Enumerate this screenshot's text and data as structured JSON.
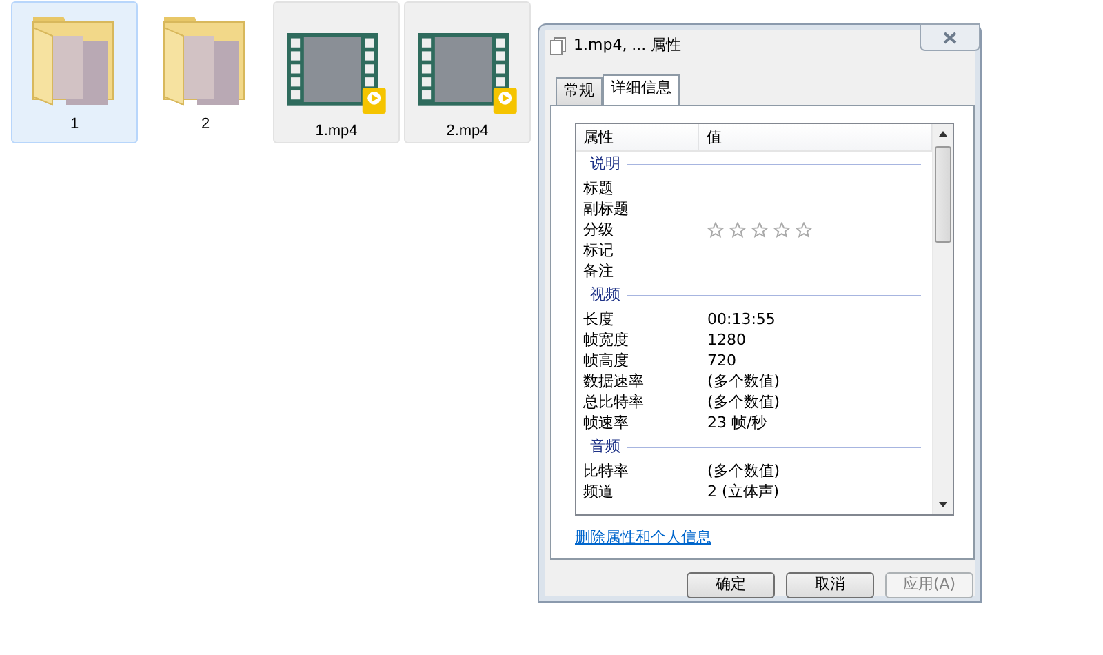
{
  "files": [
    {
      "name": "1",
      "kind": "folder",
      "selected": true
    },
    {
      "name": "2",
      "kind": "folder",
      "selected": false
    },
    {
      "name": "1.mp4",
      "kind": "video",
      "selected": false
    },
    {
      "name": "2.mp4",
      "kind": "video",
      "selected": false
    }
  ],
  "dialog": {
    "title": "1.mp4, ... 属性",
    "tabs": [
      {
        "label": "常规",
        "selected": false
      },
      {
        "label": "详细信息",
        "selected": true
      }
    ],
    "columns": [
      "属性",
      "值"
    ],
    "groups": [
      {
        "title": "说明",
        "rows": [
          {
            "name": "标题"
          },
          {
            "name": "副标题"
          },
          {
            "name": "分级",
            "kind": "stars",
            "stars": 0
          },
          {
            "name": "标记"
          },
          {
            "name": "备注"
          }
        ]
      },
      {
        "title": "视频",
        "rows": [
          {
            "name": "长度",
            "value": "00:13:55"
          },
          {
            "name": "帧宽度",
            "value": "1280"
          },
          {
            "name": "帧高度",
            "value": "720"
          },
          {
            "name": "数据速率",
            "value": "(多个数值)"
          },
          {
            "name": "总比特率",
            "value": "(多个数值)"
          },
          {
            "name": "帧速率",
            "value": "23 帧/秒"
          }
        ]
      },
      {
        "title": "音频",
        "rows": [
          {
            "name": "比特率",
            "value": "(多个数值)"
          },
          {
            "name": "频道",
            "value": "2 (立体声)"
          }
        ]
      }
    ],
    "link": "删除属性和个人信息",
    "buttons": [
      {
        "label": "确定",
        "disabled": false
      },
      {
        "label": "取消",
        "disabled": false
      },
      {
        "label": "应用(A)",
        "disabled": true
      }
    ]
  }
}
